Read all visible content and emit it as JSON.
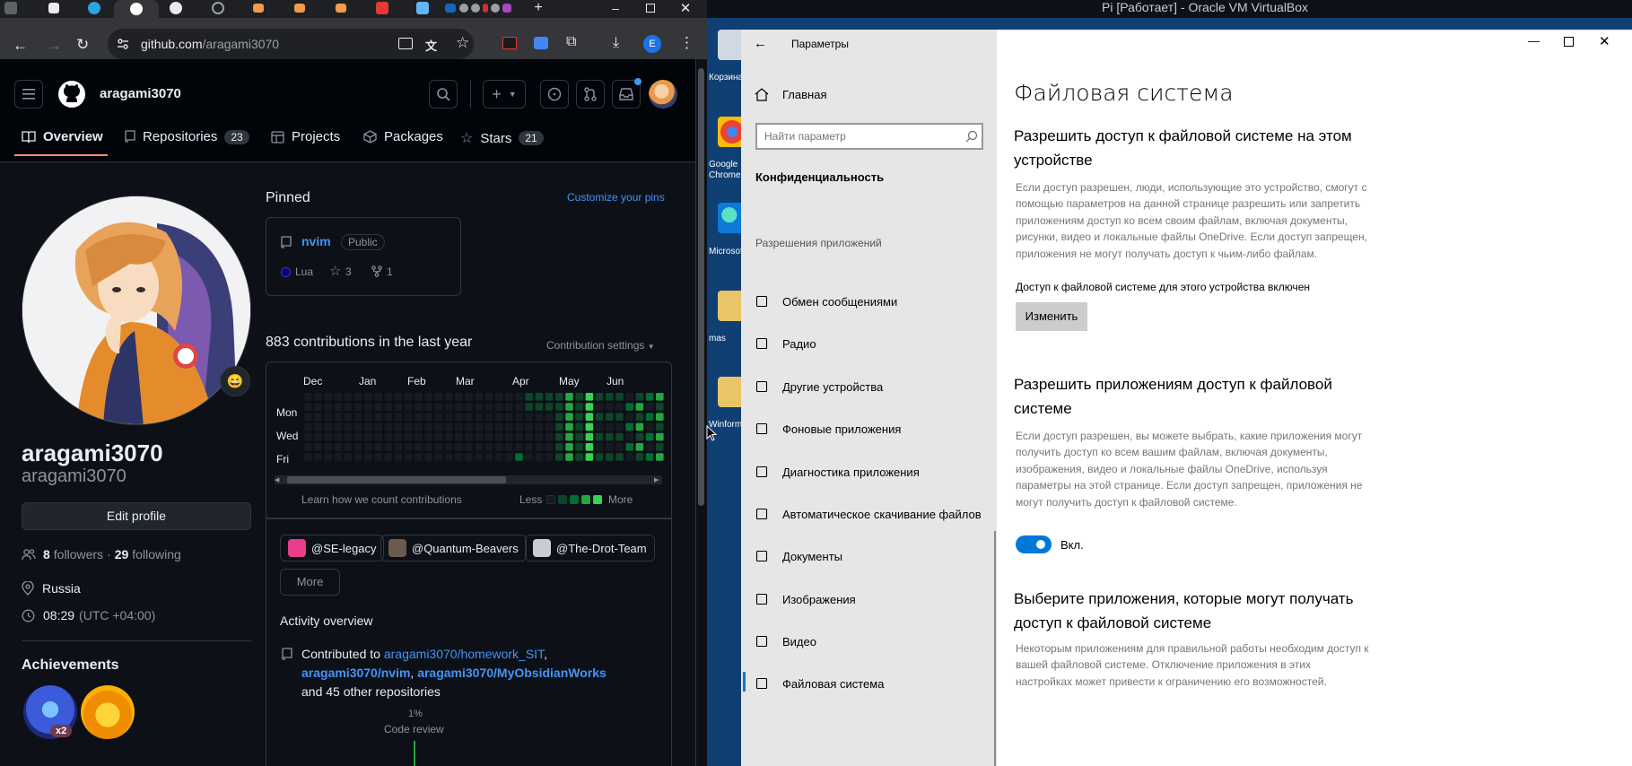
{
  "browser": {
    "url_host": "github.com",
    "url_path": "/aragami3070",
    "profile_letter": "E"
  },
  "github": {
    "username": "aragami3070",
    "nav": {
      "overview": "Overview",
      "repositories": "Repositories",
      "repositories_count": "23",
      "projects": "Projects",
      "packages": "Packages",
      "stars": "Stars",
      "stars_count": "21"
    },
    "profile": {
      "display_name": "aragami3070",
      "login": "aragami3070",
      "edit_button": "Edit profile",
      "followers_count": "8",
      "followers_label": "followers",
      "separator": "·",
      "following_count": "29",
      "following_label": "following",
      "location": "Russia",
      "local_time": "08:29",
      "timezone": "(UTC +04:00)",
      "achievements_title": "Achievements",
      "achievement_badge": "x2",
      "status_emoji": "😄"
    },
    "pinned": {
      "title": "Pinned",
      "customize": "Customize your pins",
      "repo_name": "nvim",
      "repo_visibility": "Public",
      "language": "Lua",
      "language_color": "#000080",
      "stars": "3",
      "forks": "1"
    },
    "contributions": {
      "summary": "883 contributions in the last year",
      "settings": "Contribution settings",
      "months": [
        "Dec",
        "Jan",
        "Feb",
        "Mar",
        "Apr",
        "May",
        "Jun"
      ],
      "days": [
        "Mon",
        "Wed",
        "Fri"
      ],
      "learn": "Learn how we count contributions",
      "less": "Less",
      "more": "More"
    },
    "orgs": [
      "@SE-legacy",
      "@Quantum-Beavers",
      "@The-Drot-Team"
    ],
    "orgs_more": "More",
    "activity": {
      "title": "Activity overview",
      "contributed_to": "Contributed to",
      "repo1": "aragami3070/homework_SIT",
      "comma": ",",
      "repo2": "aragami3070/nvim",
      "repo3": "aragami3070/MyObsidianWorks",
      "others": "and 45 other repositories",
      "code_review_pct": "1%",
      "code_review_label": "Code review"
    }
  },
  "vbox": {
    "title": "Pi [Работает] - Oracle VM VirtualBox",
    "desktop_icons": [
      "Корзина",
      "Google Chrome",
      "Microsoft",
      "mas",
      "Winform"
    ]
  },
  "settings": {
    "window_title": "Параметры",
    "home": "Главная",
    "search_placeholder": "Найти параметр",
    "section": "Конфиденциальность",
    "group": "Разрешения приложений",
    "menu": [
      "Обмен сообщениями",
      "Радио",
      "Другие устройства",
      "Фоновые приложения",
      "Диагностика приложения",
      "Автоматическое скачивание файлов",
      "Документы",
      "Изображения",
      "Видео",
      "Файловая система"
    ],
    "page_title": "Файловая система",
    "s1_title": "Разрешить доступ к файловой системе на этом устройстве",
    "s1_text": "Если доступ разрешен, люди, использующие это устройство, смогут с помощью параметров на данной странице разрешить или запретить приложениям доступ ко всем своим файлам, включая документы, рисунки, видео и локальные файлы OneDrive. Если доступ запрещен, приложения не могут получать доступ к чьим-либо файлам.",
    "s1_status": "Доступ к файловой системе для этого устройства включен",
    "s1_button": "Изменить",
    "s2_title": "Разрешить приложениям доступ к файловой системе",
    "s2_text": "Если доступ разрешен, вы можете выбрать, какие приложения могут получить доступ ко всем вашим файлам, включая документы, изображения, видео и локальные файлы OneDrive, используя параметры на этой странице. Если доступ запрещен, приложения не могут получить доступ к файловой системе.",
    "toggle_state": "Вкл.",
    "s3_title": "Выберите приложения, которые могут получать доступ к файловой системе",
    "s3_text": "Некоторым приложениям для правильной работы необходим доступ к вашей файловой системе. Отключение приложения в этих настройках может привести к ограничению его возможностей."
  }
}
